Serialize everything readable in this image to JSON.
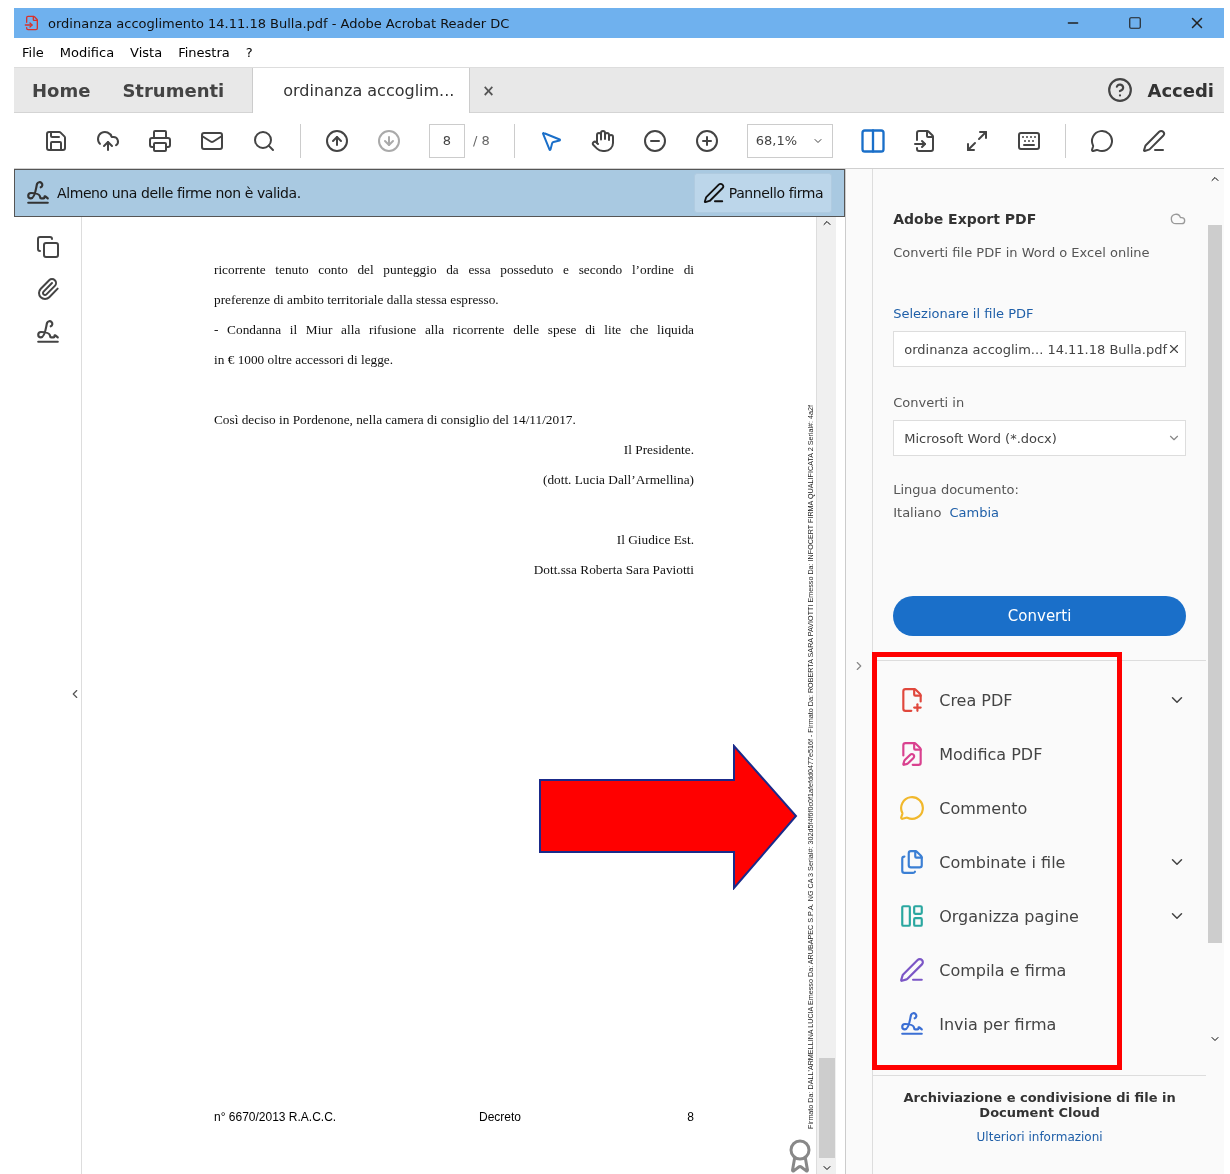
{
  "window": {
    "title": "ordinanza accoglimento 14.11.18 Bulla.pdf - Adobe Acrobat Reader DC"
  },
  "menu": [
    "File",
    "Modifica",
    "Vista",
    "Finestra",
    "?"
  ],
  "tabs": [
    {
      "label": "Home",
      "kind": "nav",
      "selected": false
    },
    {
      "label": "Strumenti",
      "kind": "nav",
      "selected": false
    },
    {
      "label": "ordinanza accoglim...",
      "kind": "document",
      "selected": true,
      "close": "×"
    }
  ],
  "account": {
    "label": "Accedi"
  },
  "toolbar": {
    "page_current": "8",
    "page_total": "/ 8",
    "zoom": "68,1%"
  },
  "signature_bar": {
    "message": "Almeno una delle firme non è valida.",
    "button": "Pannello firma"
  },
  "document": {
    "paragraphs": [
      {
        "lines": [
          {
            "text": "ricorrente tenuto conto del punteggio da essa posseduto e secondo l’ordine di",
            "kind": "justified"
          },
          {
            "text": "preferenze di ambito territoriale dalla stessa espresso.",
            "kind": "plain"
          },
          {
            "text": "- Condanna il Miur alla rifusione alla ricorrente delle spese di lite che liquida",
            "kind": "justified"
          },
          {
            "text": "in € 1000 oltre accessori di legge.",
            "kind": "plain"
          }
        ]
      },
      {
        "lines": [
          {
            "text": "Così deciso in Pordenone, nella camera di consiglio del 14/11/2017.",
            "kind": "plain"
          },
          {
            "text": "Il Presidente.",
            "kind": "signature"
          },
          {
            "text": "(dott. Lucia Dall’Armellina)",
            "kind": "signature"
          }
        ]
      },
      {
        "lines": [
          {
            "text": "Il Giudice Est.",
            "kind": "signature"
          },
          {
            "text": "Dott.ssa Roberta Sara Paviotti",
            "kind": "signature"
          }
        ]
      }
    ],
    "footer": {
      "number": "n° 6670/2013 R.A.C.C.",
      "title": "Decreto",
      "page": "8"
    },
    "stamp": "Firmato Da: DALL'ARMELLINA LUCIA Emesso Da: ARUBAPEC S.P.A. NG CA 3 Serial#: 302d5f4f6f0c0f1afefdd0477e516f - Firmato Da: ROBERTA SARA PAVIOTTI Emesso Da: INFOCERT FIRMA QUALIFICATA 2 Serial#: 4a2f"
  },
  "export_panel": {
    "title": "Adobe Export PDF",
    "subtitle": "Converti file PDF in Word o Excel online",
    "select_label": "Selezionare il file PDF",
    "file_value": "ordinanza accoglim... 14.11.18 Bulla.pdf",
    "convert_label": "Converti in",
    "format_value": "Microsoft Word (*.docx)",
    "language_label": "Lingua documento:",
    "language": "Italiano",
    "change_link": "Cambia",
    "button": "Converti"
  },
  "tools": [
    {
      "label": "Crea PDF",
      "kind": "create",
      "expandable": true
    },
    {
      "label": "Modifica PDF",
      "kind": "edit",
      "expandable": false
    },
    {
      "label": "Commento",
      "kind": "comment",
      "expandable": false
    },
    {
      "label": "Combinate i file",
      "kind": "combine",
      "expandable": true
    },
    {
      "label": "Organizza pagine",
      "kind": "organize",
      "expandable": true
    },
    {
      "label": "Compila e firma",
      "kind": "fill",
      "expandable": false
    },
    {
      "label": "Invia per firma",
      "kind": "send",
      "expandable": false
    }
  ],
  "cloud": {
    "text": "Archiviazione e condivisione di file in Document Cloud",
    "link": "Ulteriori informazioni"
  }
}
